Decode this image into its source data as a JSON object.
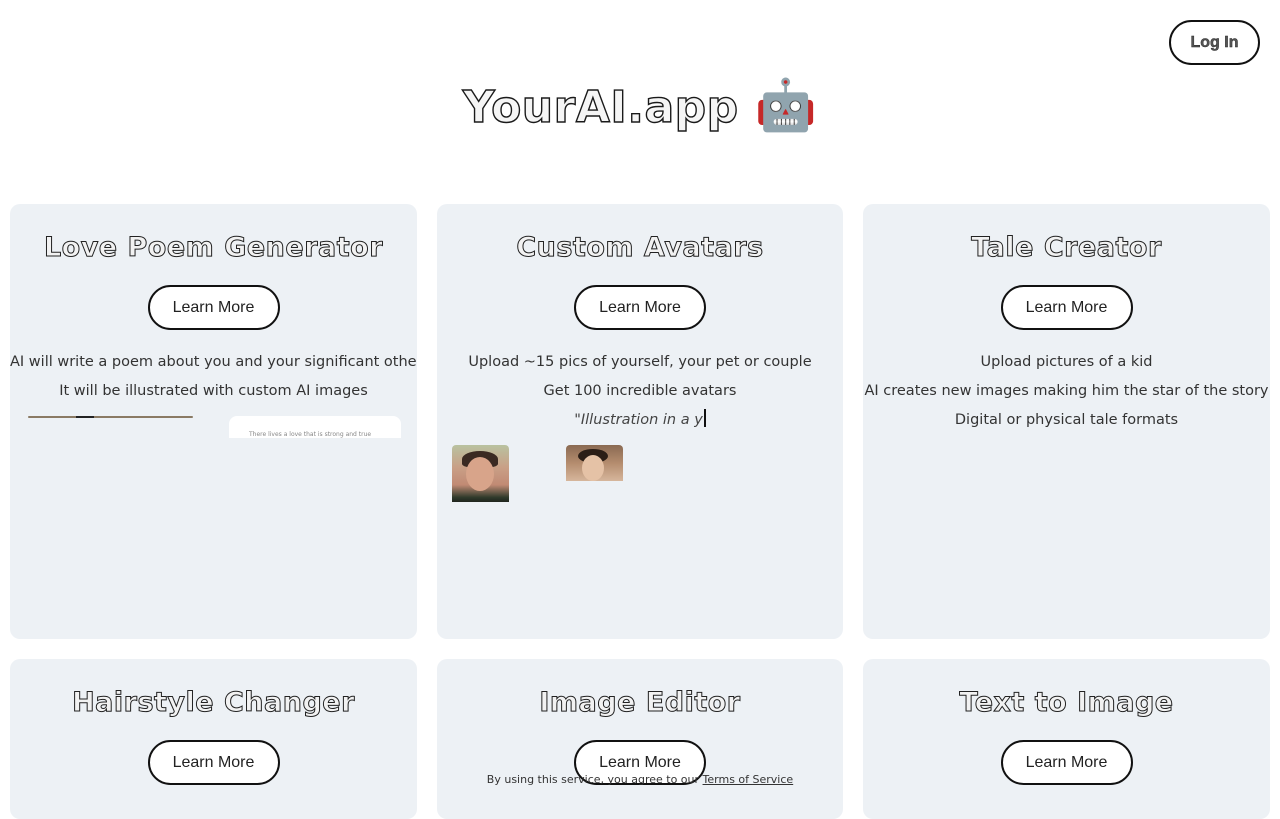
{
  "header": {
    "login_label": "Log In",
    "title": "YourAI.app",
    "title_emoji": "🤖"
  },
  "cards": [
    {
      "title": "Love Poem Generator",
      "button": "Learn More",
      "lines": [
        "AI will write a poem about you and your significant other",
        "It will be illustrated with custom AI images"
      ]
    },
    {
      "title": "Custom Avatars",
      "button": "Learn More",
      "lines": [
        "Upload ~15 pics of yourself, your pet or couple",
        "Get 100 incredible avatars"
      ],
      "typing": "\"Illustration in a y"
    },
    {
      "title": "Tale Creator",
      "button": "Learn More",
      "lines": [
        "Upload pictures of a kid",
        "AI creates new images making him the star of the story",
        "Digital or physical tale formats"
      ]
    },
    {
      "title": "Hairstyle Changer",
      "button": "Learn More"
    },
    {
      "title": "Image Editor",
      "button": "Learn More"
    },
    {
      "title": "Text to Image",
      "button": "Learn More"
    }
  ],
  "footer": {
    "text": "By using this service, you agree to our",
    "link": "Terms of Service"
  }
}
